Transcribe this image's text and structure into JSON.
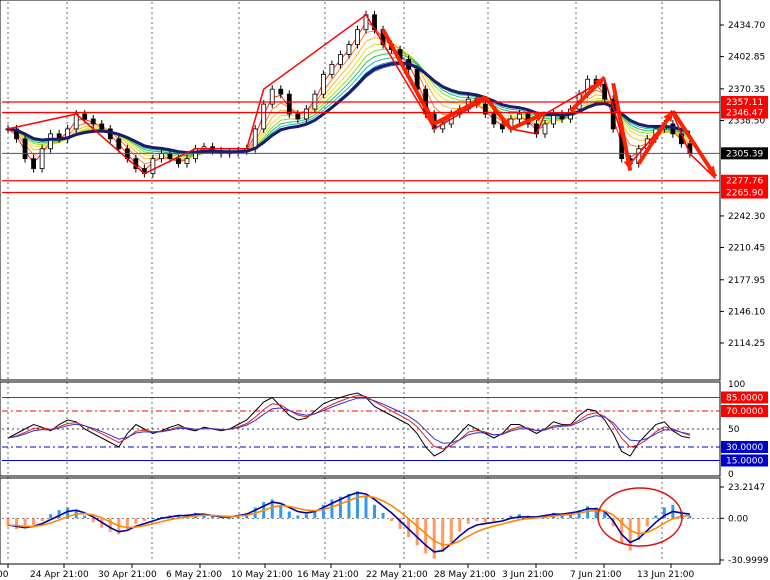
{
  "chart_data": {
    "type": "candlestick",
    "instrument": "XAUUSD",
    "timeframe": "H4",
    "price_axis": {
      "min": 2100,
      "max": 2450,
      "ticks": [
        "2434.70",
        "2402.85",
        "2370.35",
        "2338.50",
        "2305.39",
        "2242.30",
        "2210.45",
        "2177.95",
        "2146.10",
        "2114.25"
      ],
      "tick_values": [
        2434.7,
        2402.85,
        2370.35,
        2338.5,
        2305.39,
        2242.3,
        2210.45,
        2177.95,
        2146.1,
        2114.25
      ]
    },
    "current_price": {
      "label": "2305.39",
      "value": 2305.39,
      "color": "#000000"
    },
    "horizontal_levels": [
      {
        "label": "2357.11",
        "value": 2357.11,
        "color": "#ff0000"
      },
      {
        "label": "2346.47",
        "value": 2346.47,
        "color": "#ff0000"
      },
      {
        "label": "2277.76",
        "value": 2277.76,
        "color": "#ff0000"
      },
      {
        "label": "2265.90",
        "value": 2265.9,
        "color": "#ff0000"
      }
    ],
    "x_axis_labels": [
      ":00",
      "24 Apr 21:00",
      "30 Apr 21:00",
      "6 May 21:00",
      "10 May 21:00",
      "16 May 21:00",
      "22 May 21:00",
      "28 May 21:00",
      "3 Jun 21:00",
      "7 Jun 21:00",
      "13 Jun 21:00"
    ],
    "price_series_approx": [
      2330,
      2320,
      2300,
      2290,
      2310,
      2325,
      2320,
      2330,
      2345,
      2340,
      2335,
      2330,
      2320,
      2310,
      2300,
      2290,
      2285,
      2300,
      2305,
      2300,
      2295,
      2300,
      2310,
      2312,
      2308,
      2305,
      2306,
      2308,
      2310,
      2330,
      2355,
      2370,
      2365,
      2345,
      2340,
      2350,
      2365,
      2385,
      2395,
      2405,
      2415,
      2430,
      2445,
      2430,
      2415,
      2410,
      2400,
      2390,
      2370,
      2345,
      2330,
      2335,
      2345,
      2350,
      2360,
      2355,
      2345,
      2335,
      2330,
      2340,
      2345,
      2335,
      2325,
      2335,
      2345,
      2340,
      2350,
      2365,
      2380,
      2375,
      2360,
      2330,
      2300,
      2295,
      2310,
      2320,
      2330,
      2335,
      2325,
      2315,
      2305
    ],
    "rsi_panel": {
      "ticks": [
        "100",
        "85.0000",
        "70.0000",
        "50",
        "30.0000",
        "15.0000",
        "0"
      ],
      "tick_values": [
        100,
        85,
        70,
        50,
        30,
        15,
        0
      ],
      "level_colors": {
        "85": "#ff0000",
        "70": "#ff0000",
        "30": "#0000cc",
        "15": "#0000cc"
      },
      "series_approx": [
        40,
        45,
        50,
        55,
        52,
        48,
        55,
        60,
        58,
        50,
        45,
        40,
        35,
        30,
        45,
        55,
        50,
        45,
        48,
        52,
        55,
        50,
        48,
        52,
        50,
        48,
        50,
        55,
        60,
        70,
        80,
        85,
        75,
        65,
        60,
        62,
        70,
        78,
        82,
        85,
        88,
        90,
        85,
        75,
        70,
        65,
        60,
        55,
        45,
        30,
        20,
        25,
        35,
        45,
        55,
        50,
        45,
        40,
        45,
        55,
        55,
        50,
        45,
        50,
        58,
        55,
        55,
        65,
        72,
        70,
        60,
        45,
        25,
        20,
        35,
        45,
        55,
        58,
        48,
        42,
        40
      ]
    },
    "macd_panel": {
      "ticks": [
        "23.2147",
        "0.00",
        "-30.9999"
      ],
      "tick_values": [
        23.2147,
        0,
        -30.9999
      ],
      "histogram_approx": [
        -6,
        -8,
        -7,
        -5,
        -2,
        3,
        6,
        8,
        6,
        2,
        -3,
        -7,
        -10,
        -12,
        -8,
        -4,
        -2,
        0,
        1,
        2,
        2,
        3,
        4,
        3,
        2,
        1,
        0,
        2,
        4,
        8,
        12,
        14,
        10,
        5,
        2,
        3,
        6,
        10,
        14,
        16,
        18,
        20,
        17,
        10,
        4,
        -2,
        -8,
        -14,
        -20,
        -26,
        -30,
        -25,
        -18,
        -10,
        -4,
        -2,
        -3,
        -2,
        0,
        2,
        3,
        2,
        1,
        2,
        4,
        3,
        4,
        6,
        9,
        8,
        5,
        -6,
        -18,
        -24,
        -16,
        -6,
        2,
        8,
        10,
        5,
        2
      ],
      "line_main_approx": [
        -5,
        -6,
        -7,
        -6,
        -4,
        -1,
        2,
        5,
        6,
        4,
        1,
        -3,
        -7,
        -10,
        -9,
        -6,
        -4,
        -2,
        0,
        1,
        2,
        2,
        3,
        3,
        2,
        1,
        1,
        2,
        3,
        6,
        9,
        12,
        11,
        8,
        5,
        4,
        5,
        8,
        11,
        14,
        17,
        19,
        18,
        14,
        9,
        4,
        -2,
        -8,
        -14,
        -20,
        -25,
        -24,
        -19,
        -13,
        -8,
        -5,
        -4,
        -3,
        -2,
        0,
        1,
        1,
        1,
        2,
        3,
        3,
        4,
        5,
        7,
        7,
        5,
        -2,
        -12,
        -18,
        -15,
        -9,
        -3,
        2,
        5,
        4,
        3
      ]
    }
  }
}
